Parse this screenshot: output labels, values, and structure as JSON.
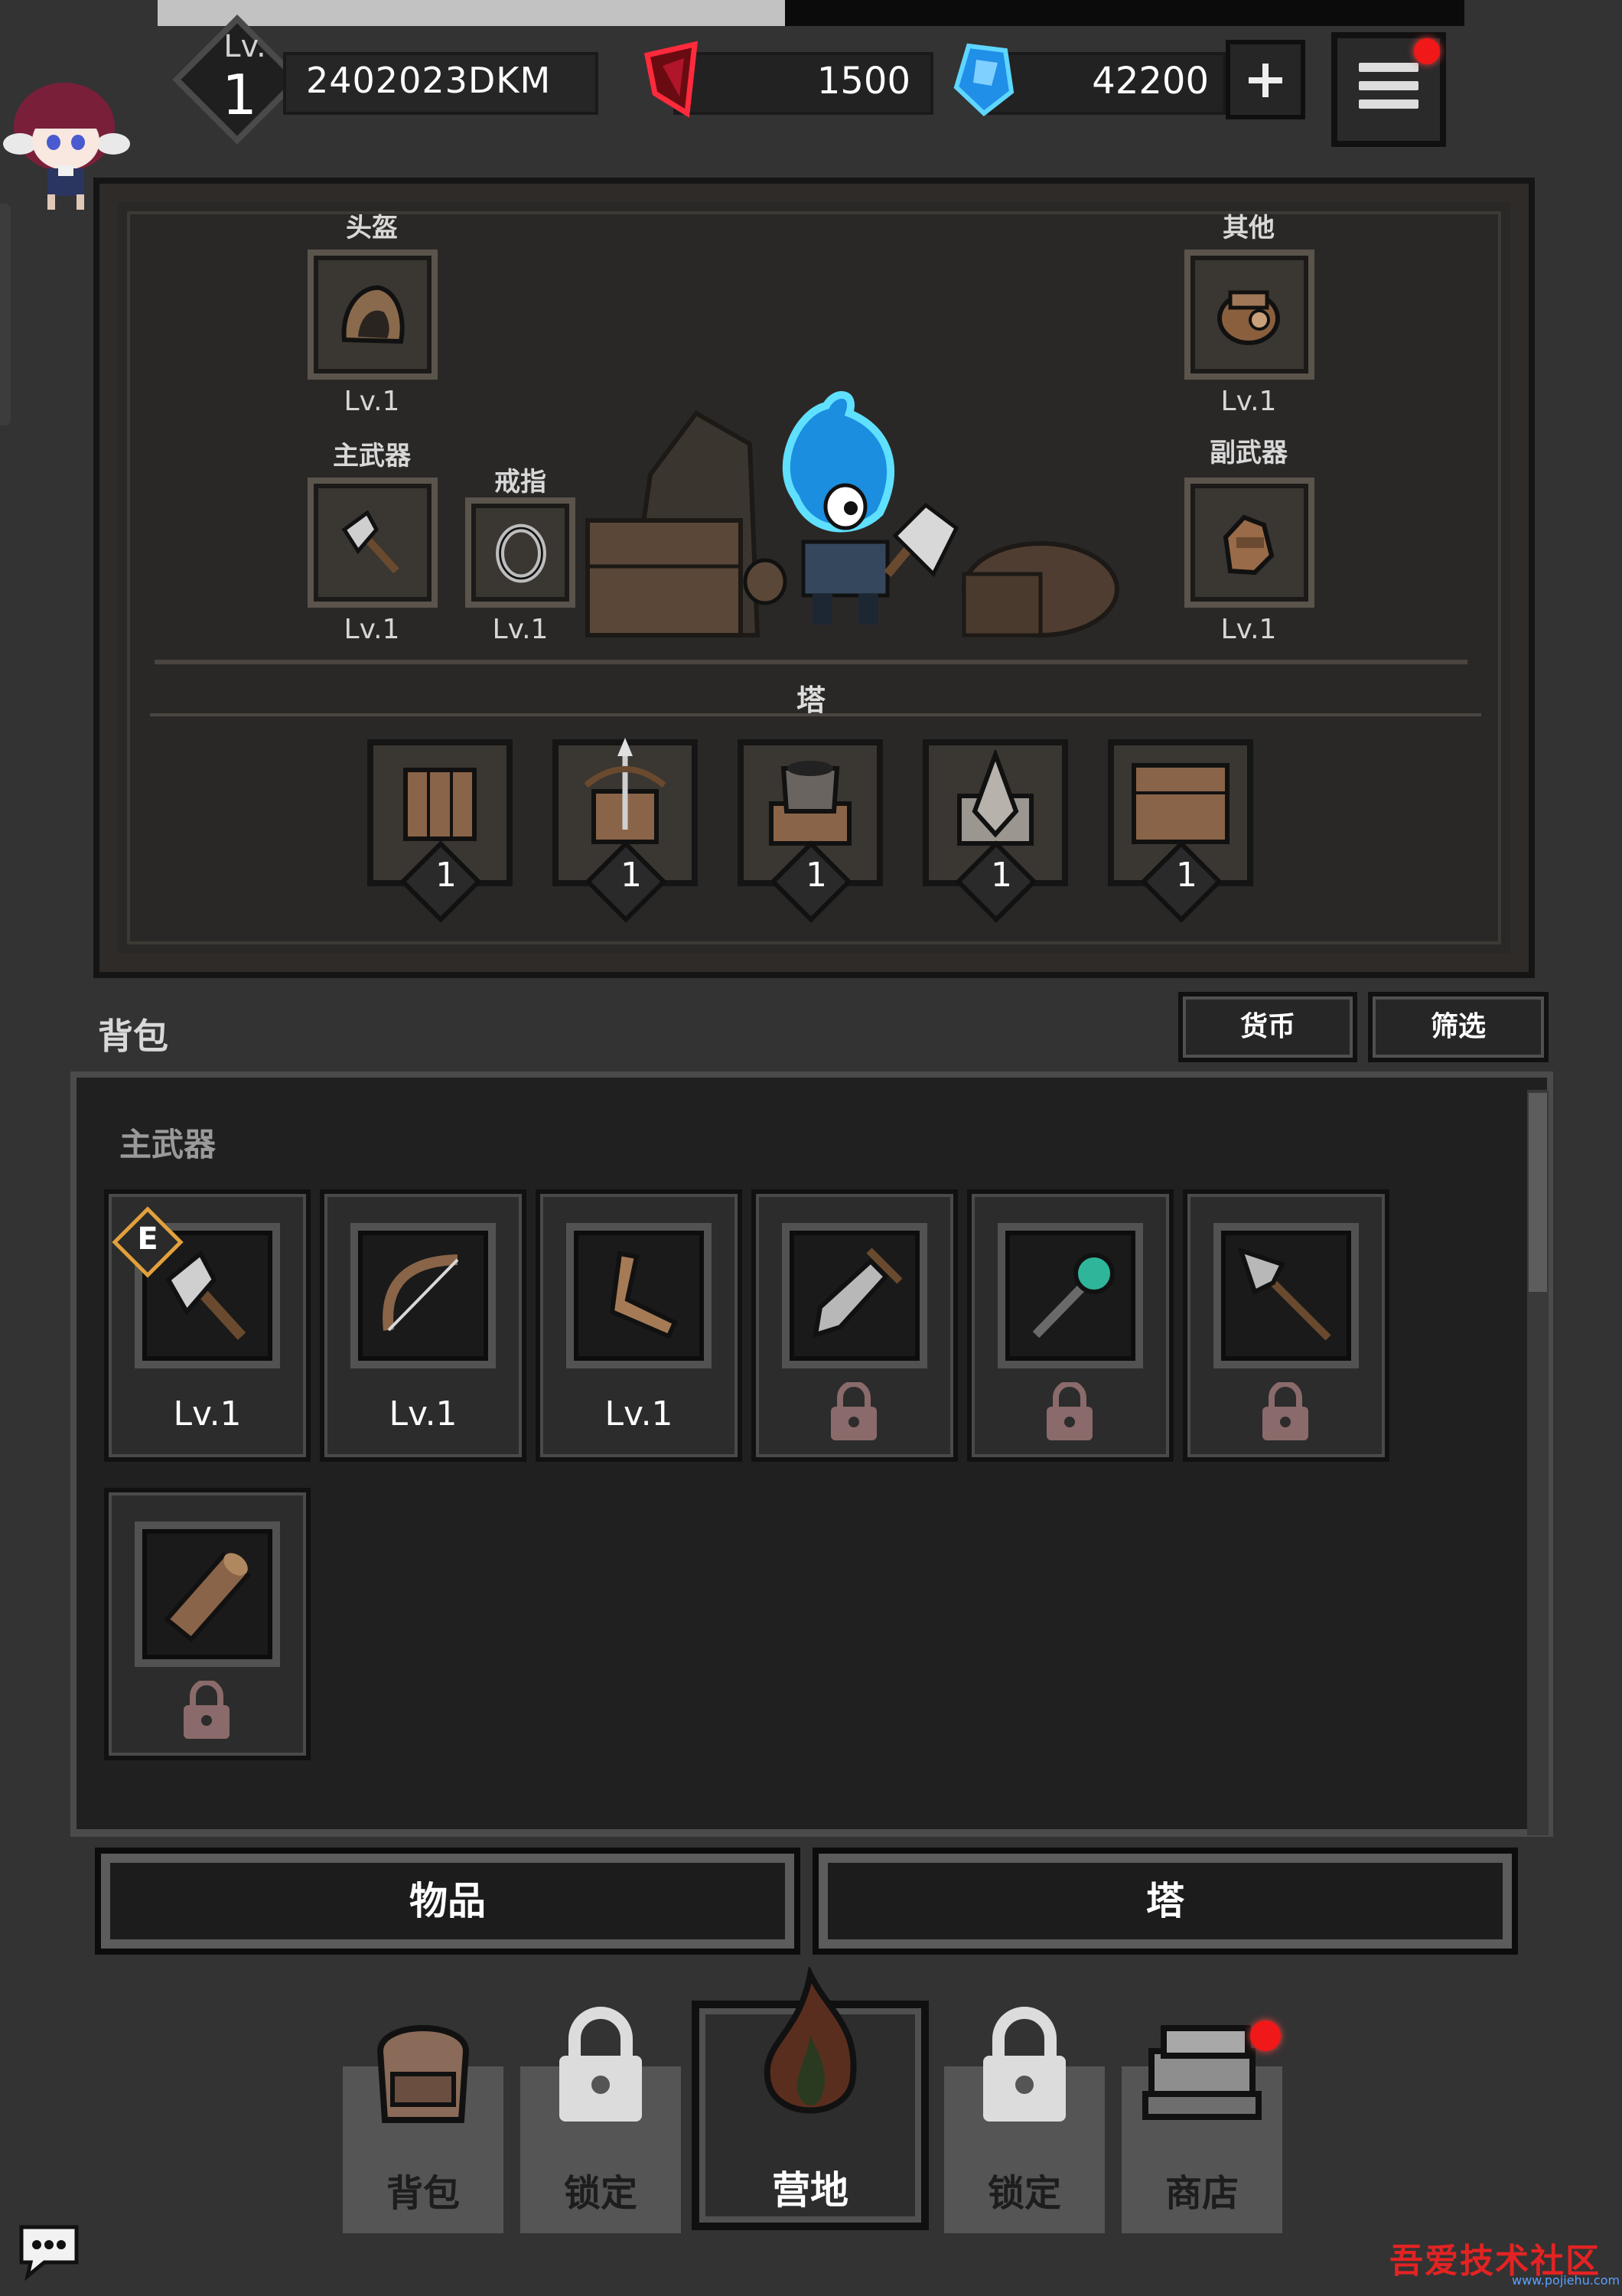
{
  "header": {
    "top_progress": 0.48,
    "level_label": "Lv.",
    "level_value": "1",
    "player_id": "2402023DKM",
    "red_gems": "1500",
    "blue_gems": "42200",
    "red_gem_icon": "red-gem-icon",
    "blue_gem_icon": "blue-gem-icon",
    "add_icon": "plus-icon",
    "menu_icon": "hamburger-menu-icon",
    "notification_color": "#f01818"
  },
  "equipment": {
    "helmet": {
      "label": "头盔",
      "level": "Lv.1",
      "icon": "hood-icon"
    },
    "other": {
      "label": "其他",
      "level": "Lv.1",
      "icon": "pouch-icon"
    },
    "main_weapon": {
      "label": "主武器",
      "level": "Lv.1",
      "icon": "axe-icon"
    },
    "ring": {
      "label": "戒指",
      "level": "Lv.1",
      "icon": "ring-icon"
    },
    "sub_weapon": {
      "label": "副武器",
      "level": "Lv.1",
      "icon": "glove-icon"
    },
    "tower_title": "塔",
    "towers": [
      {
        "level": "1",
        "icon": "wall-tower-icon"
      },
      {
        "level": "1",
        "icon": "crossbow-tower-icon"
      },
      {
        "level": "1",
        "icon": "cannon-tower-icon"
      },
      {
        "level": "1",
        "icon": "spike-tower-icon"
      },
      {
        "level": "1",
        "icon": "plank-tower-icon"
      }
    ]
  },
  "backpack": {
    "title": "背包",
    "currency_button": "货币",
    "filter_button": "筛选",
    "section_title": "主武器",
    "equipped_badge": "E",
    "items": [
      {
        "icon": "axe-icon",
        "level": "Lv.1",
        "locked": false,
        "equipped": true
      },
      {
        "icon": "bow-icon",
        "level": "Lv.1",
        "locked": false,
        "equipped": false
      },
      {
        "icon": "boomerang-icon",
        "level": "Lv.1",
        "locked": false,
        "equipped": false
      },
      {
        "icon": "sword-icon",
        "level": "",
        "locked": true,
        "equipped": false
      },
      {
        "icon": "staff-icon",
        "level": "",
        "locked": true,
        "equipped": false
      },
      {
        "icon": "spear-icon",
        "level": "",
        "locked": true,
        "equipped": false
      },
      {
        "icon": "log-icon",
        "level": "",
        "locked": true,
        "equipped": false
      }
    ]
  },
  "tabs": {
    "items": "物品",
    "tower": "塔"
  },
  "nav": {
    "backpack": "背包",
    "locked_1": "锁定",
    "camp": "营地",
    "locked_2": "锁定",
    "shop": "商店"
  },
  "watermark": {
    "text": "吾爱技术社区",
    "url": "www.pojiehu.com"
  }
}
